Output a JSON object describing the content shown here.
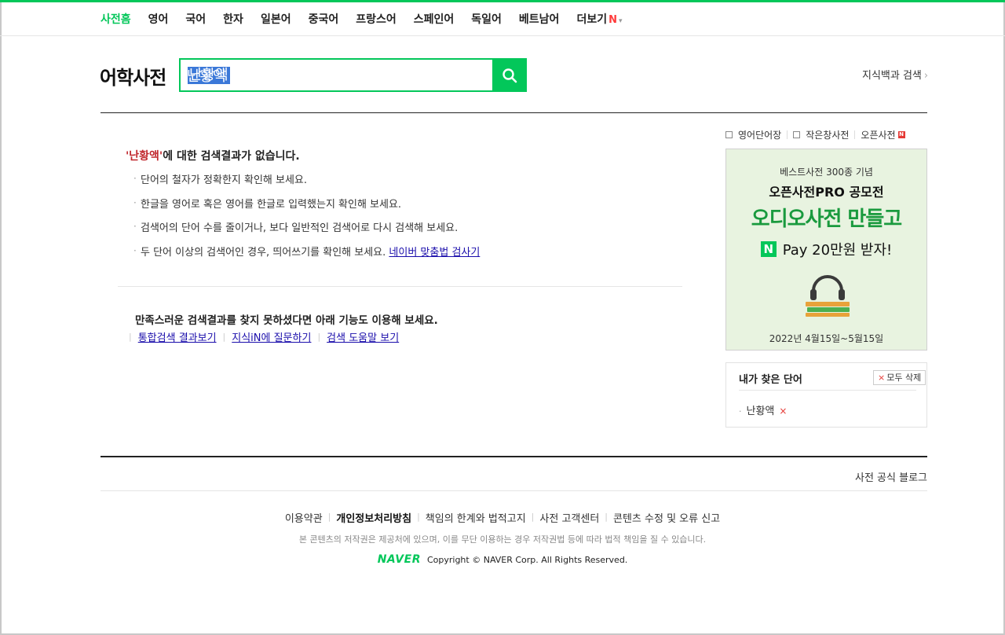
{
  "gnb": {
    "items": [
      {
        "label": "사전홈",
        "active": true
      },
      {
        "label": "영어"
      },
      {
        "label": "국어"
      },
      {
        "label": "한자"
      },
      {
        "label": "일본어"
      },
      {
        "label": "중국어"
      },
      {
        "label": "프랑스어"
      },
      {
        "label": "스페인어"
      },
      {
        "label": "독일어"
      },
      {
        "label": "베트남어"
      },
      {
        "label": "더보기"
      }
    ],
    "more_badge": "N"
  },
  "header": {
    "logo": "어학사전",
    "search_value": "난황액",
    "knowledge_link": "지식백과 검색"
  },
  "result": {
    "keyword": "'난황액'",
    "title_rest": "에 대한 검색결과가 없습니다.",
    "tips": [
      "단어의 철자가 정확한지 확인해 보세요.",
      "한글을 영어로 혹은 영어를 한글로 입력했는지 확인해 보세요.",
      "검색어의 단어 수를 줄이거나, 보다 일반적인 검색어로 다시 검색해 보세요.",
      "두 단어 이상의 검색어인 경우, 띄어쓰기를 확인해 보세요."
    ],
    "spell_link": "네이버 맞춤법 검사기",
    "more_title": "만족스러운 검색결과를 찾지 못하셨다면 아래 기능도 이용해 보세요.",
    "more_links": [
      "통합검색 결과보기",
      "지식iN에 질문하기",
      "검색 도움말 보기"
    ]
  },
  "side": {
    "tools": [
      "영어단어장",
      "작은창사전",
      "오픈사전"
    ],
    "tool_badge": "N",
    "banner": {
      "line1": "베스트사전 300종 기념",
      "line2": "오픈사전PRO 공모전",
      "line3": "오디오사전 만들고",
      "npay_icon": "N",
      "line4": "Pay 20만원 받자!",
      "date": "2022년 4월15일~5월15일"
    },
    "my_words": {
      "title": "내가 찾은 단어",
      "clear_label": "모두 삭제",
      "items": [
        "난황액"
      ]
    }
  },
  "footer": {
    "blog_link": "사전 공식 블로그",
    "links": [
      "이용약관",
      "개인정보처리방침",
      "책임의 한계와 법적고지",
      "사전 고객센터",
      "콘텐츠 수정 및 오류 신고"
    ],
    "note": "본 콘텐츠의 저작권은 제공처에 있으며, 이를 무단 이용하는 경우 저작권법 등에 따라 법적 책임을 질 수 있습니다.",
    "logo": "NAVER",
    "copyright": "Copyright © NAVER Corp. All Rights Reserved."
  },
  "colors": {
    "brand": "#03c75a",
    "keyword": "#c0272d",
    "link": "#1a0dab"
  }
}
